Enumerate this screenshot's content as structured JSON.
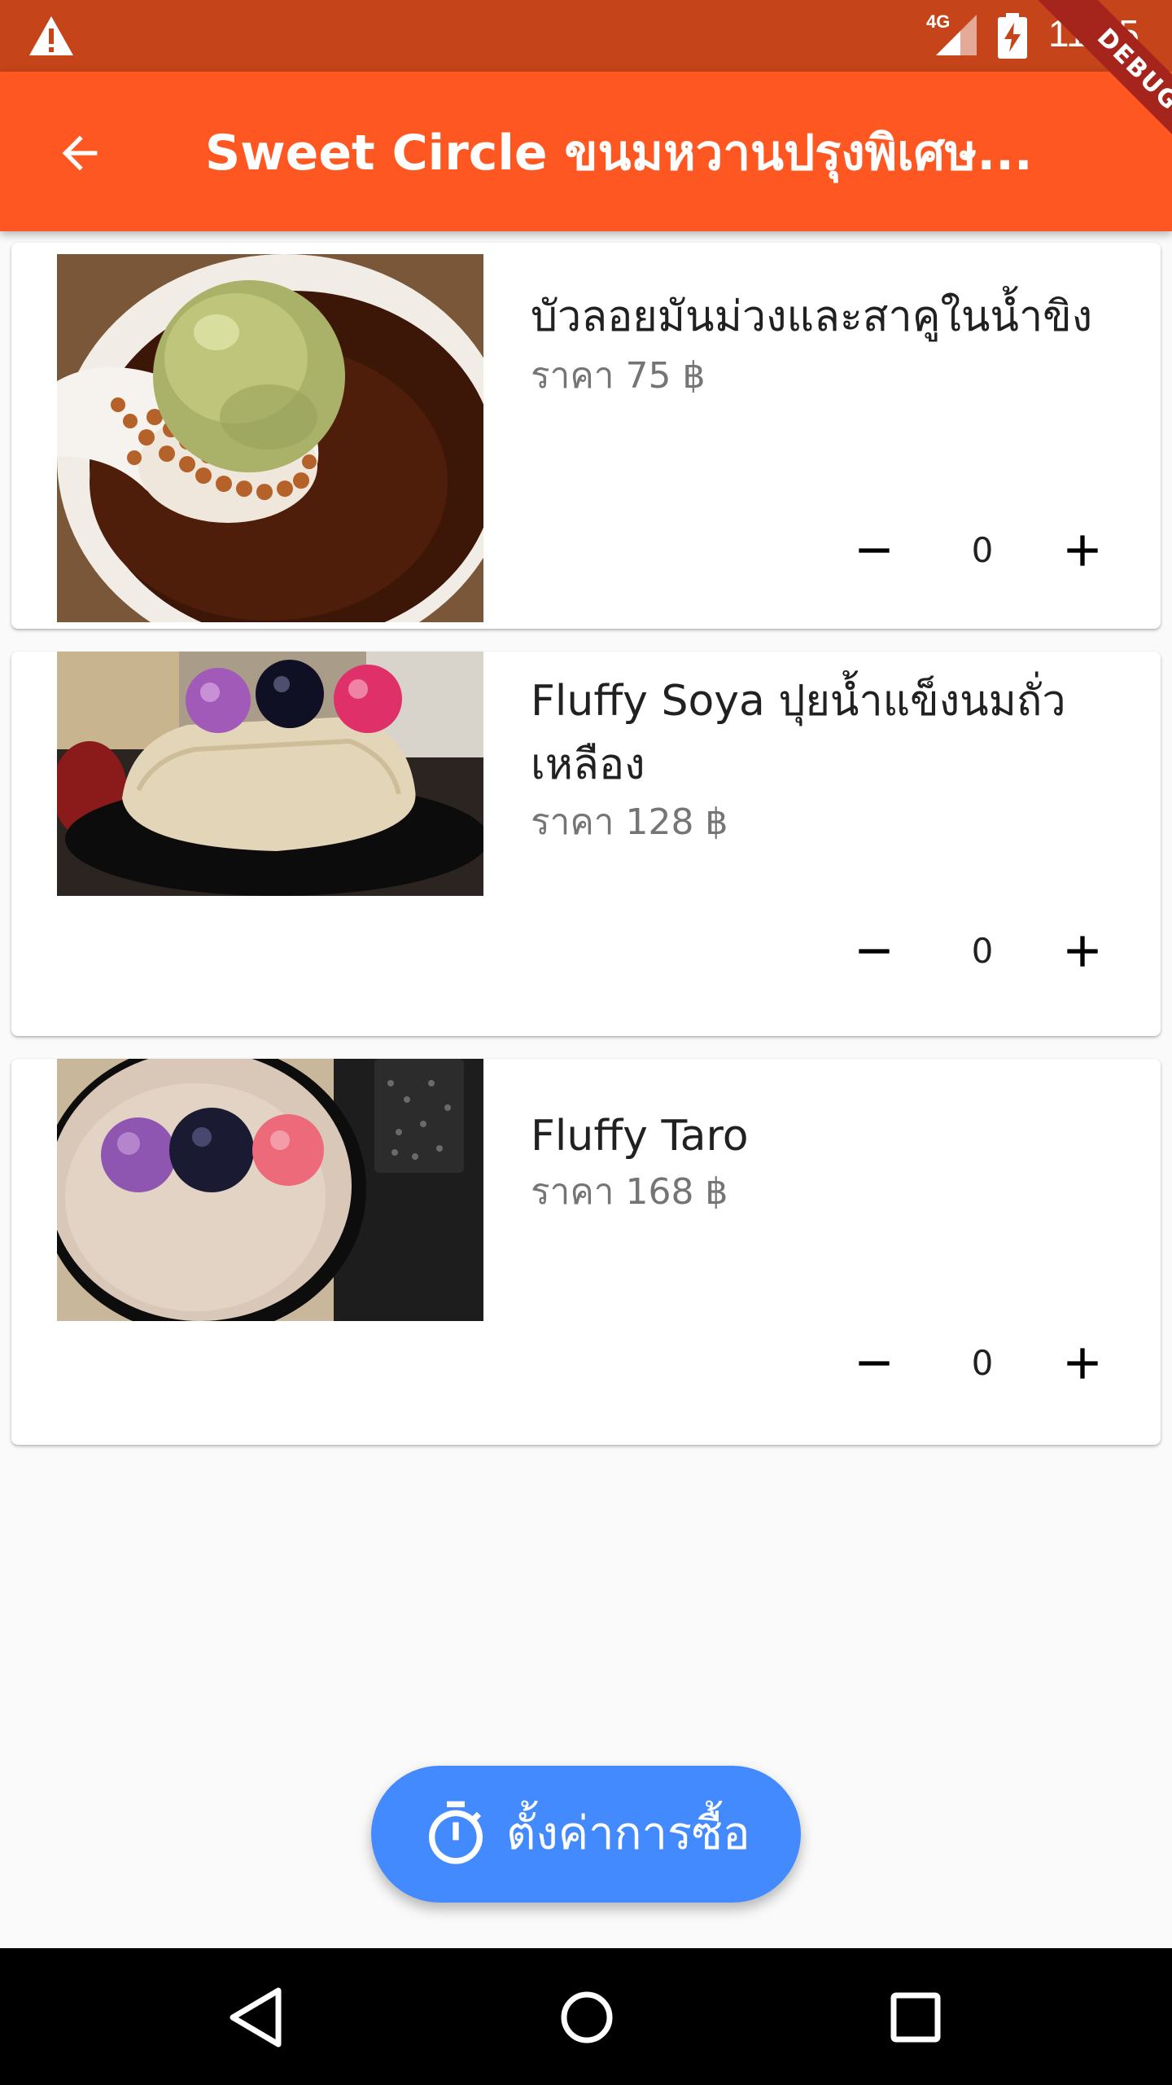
{
  "status_bar": {
    "network": "4G",
    "time": "11:55",
    "icons": [
      "warning-icon",
      "signal-icon",
      "battery-charging-icon"
    ]
  },
  "app_bar": {
    "title": "Sweet Circle ขนมหวานปรุงพิเศษ...",
    "back_icon": "arrow-left-icon"
  },
  "debug_banner": "DEBUG",
  "menu_items": [
    {
      "name": "บัวลอยมันม่วงและสาคูในน้ำขิง",
      "price": "ราคา 75 ฿",
      "quantity": "0"
    },
    {
      "name": "Fluffy Soya ปุยน้ำแข็งนมถั่วเหลือง",
      "price": "ราคา 128 ฿",
      "quantity": "0"
    },
    {
      "name": "Fluffy Taro",
      "price": "ราคา 168 ฿",
      "quantity": "0"
    }
  ],
  "fab": {
    "label": "ตั้งค่าการซื้อ",
    "icon": "timer-icon"
  },
  "colors": {
    "status_bar": "#c5441a",
    "app_bar": "#ff5722",
    "fab": "#448aff",
    "debug": "#a5251c"
  }
}
